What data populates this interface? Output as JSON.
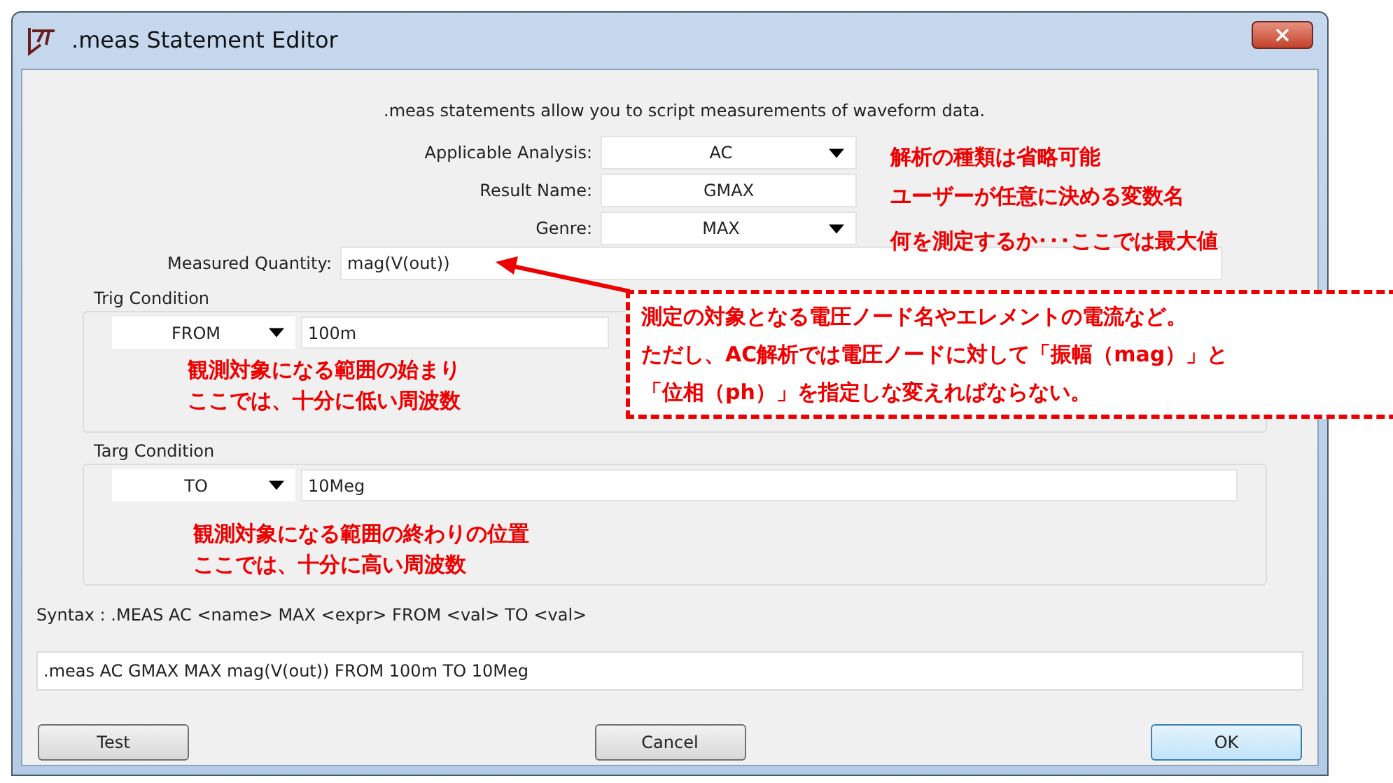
{
  "window": {
    "title": ".meas Statement Editor"
  },
  "description": ".meas statements allow you to script measurements of waveform data.",
  "fields": [
    {
      "kind": "combo",
      "label": "Applicable Analysis:",
      "value": "AC"
    },
    {
      "kind": "text",
      "label": "Result Name:",
      "value": "GMAX"
    },
    {
      "kind": "combo",
      "label": "Genre:",
      "value": "MAX"
    }
  ],
  "measured_quantity": {
    "label": "Measured Quantity:",
    "value": "mag(V(out))"
  },
  "conditions": [
    {
      "title": "Trig Condition",
      "mode": "FROM",
      "value": "100m",
      "note_lines": [
        "観測対象になる範囲の始まり",
        "ここでは、十分に低い周波数"
      ]
    },
    {
      "title": "Targ Condition",
      "mode": "TO",
      "value": "10Meg",
      "note_lines": [
        "観測対象になる範囲の終わりの位置",
        "ここでは、十分に高い周波数"
      ]
    }
  ],
  "syntax": "Syntax : .MEAS AC <name> MAX <expr> FROM <val> TO <val>",
  "statement": ".meas AC GMAX MAX mag(V(out)) FROM 100m TO 10Meg",
  "buttons": [
    {
      "label": "Test",
      "default": false
    },
    {
      "label": "Cancel",
      "default": false
    },
    {
      "label": "OK",
      "default": true
    }
  ],
  "field_notes": [
    "解析の種類は省略可能",
    "ユーザーが任意に決める変数名",
    "何を測定するか･･･ここでは最大値"
  ],
  "callout_lines": [
    "測定の対象となる電圧ノード名やエレメントの電流など。",
    "ただし、AC解析では電圧ノードに対して「振幅（mag）」と",
    "「位相（ph）」を指定しな変えればならない。"
  ]
}
